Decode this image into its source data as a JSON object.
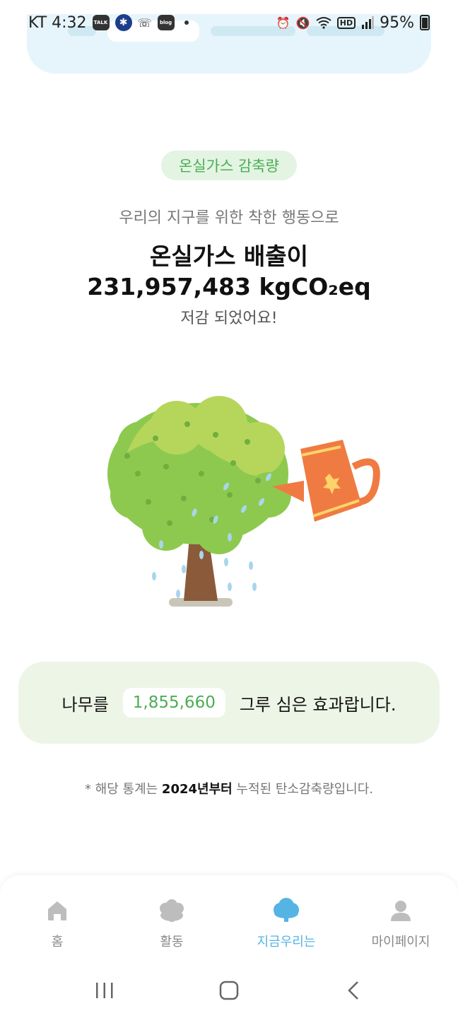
{
  "status_bar": {
    "carrier_time": "KT 4:32",
    "battery": "95%",
    "hd_label": "HD",
    "talk_label": "TALK",
    "blog_label": "blog",
    "icons": [
      "kakaotalk-icon",
      "app-icon",
      "call-icon",
      "blog-icon",
      "alarm-icon",
      "mute-icon",
      "wifi-icon",
      "signal-icon",
      "battery-icon"
    ]
  },
  "headline": {
    "pill": "온실가스 감축량",
    "subtitle": "우리의 지구를 위한 착한 행동으로",
    "line1": "온실가스 배출이",
    "line2": "231,957,483 kgCO₂eq",
    "line3": "저감 되었어요!"
  },
  "trees": {
    "prefix": "나무를",
    "count": "1,855,660",
    "suffix": "그루 심은 효과랍니다."
  },
  "footnote": {
    "pre": "* 해당 통계는 ",
    "bold": "2024년부터",
    "post": " 누적된 탄소감축량입니다."
  },
  "tabs": [
    {
      "label": "홈",
      "icon": "home-icon"
    },
    {
      "label": "활동",
      "icon": "activity-icon"
    },
    {
      "label": "지금우리는",
      "icon": "tree-icon",
      "active": true
    },
    {
      "label": "마이페이지",
      "icon": "person-icon"
    }
  ],
  "colors": {
    "accent_green": "#4cad55",
    "accent_blue": "#55b4e3",
    "card_green": "#edf5e7",
    "card_blue": "#e6f5fb"
  }
}
